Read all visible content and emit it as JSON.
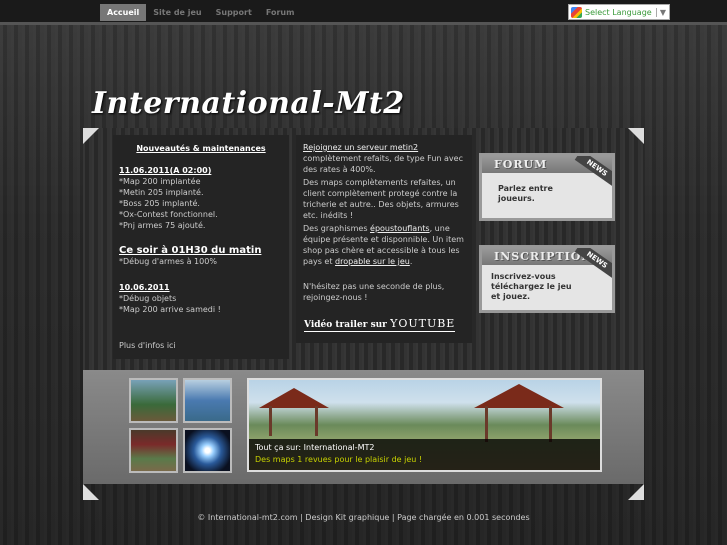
{
  "nav": {
    "items": [
      "Accueil",
      "Site de jeu",
      "Support",
      "Forum"
    ],
    "active": "Accueil"
  },
  "language": {
    "label": "Select Language"
  },
  "logo": {
    "text": "International-Mt2"
  },
  "news": {
    "heading": "Nouveautés & maintenances",
    "entry1": {
      "date": "11.06.2011(A 02:00)",
      "lines": [
        "*Map 200 implantée",
        "*Metin 205 implanté.",
        "*Boss 205 implanté.",
        "*Ox-Contest fonctionnel.",
        "*Pnj armes 75 ajouté."
      ]
    },
    "entry2": {
      "title": "Ce soir à 01H30 du matin",
      "lines": [
        "*Débug d'armes à 100%"
      ]
    },
    "entry3": {
      "date": "10.06.2011",
      "lines": [
        "*Débug objets",
        "*Map 200 arrive samedi !"
      ]
    },
    "more": "Plus d'infos ici"
  },
  "desc": {
    "p1_link": "Rejoignez un serveur metin2",
    "p1_rest": " complètement refaits, de type Fun avec des rates à 400%.",
    "p2": "Des maps complètements refaites, un client complètement protegé contre la tricherie et autre.. Des objets, armures etc. inédits !",
    "p3_a": "Des graphismes ",
    "p3_link1": "époustouflants",
    "p3_b": ", une équipe présente et disponnible. Un item shop pas chère et accessible à tous les pays et ",
    "p3_link2": "dropable sur le jeu",
    "p3_c": ".",
    "p4": "N'hésitez pas une seconde de plus, rejoingez-nous !",
    "video_label": "Vidéo trailer sur",
    "video_site": "YOUTUBE"
  },
  "banners": [
    {
      "title": "FORUM",
      "ribbon": "NEWS",
      "text_l1": "Parlez entre",
      "text_l2": "joueurs."
    },
    {
      "title": "INSCRIPTION",
      "ribbon": "NEWS",
      "text_l1": "Inscrivez-vous",
      "text_l2": "téléchargez le jeu",
      "text_l3": "et jouez."
    }
  ],
  "slideshow": {
    "caption_title": "Tout ça sur: International-MT2",
    "caption_sub": "Des maps 1 revues pour le plaisir de jeu !"
  },
  "footer": {
    "text": "© International-mt2.com | Design Kit graphique | Page chargée en 0.001 secondes"
  }
}
